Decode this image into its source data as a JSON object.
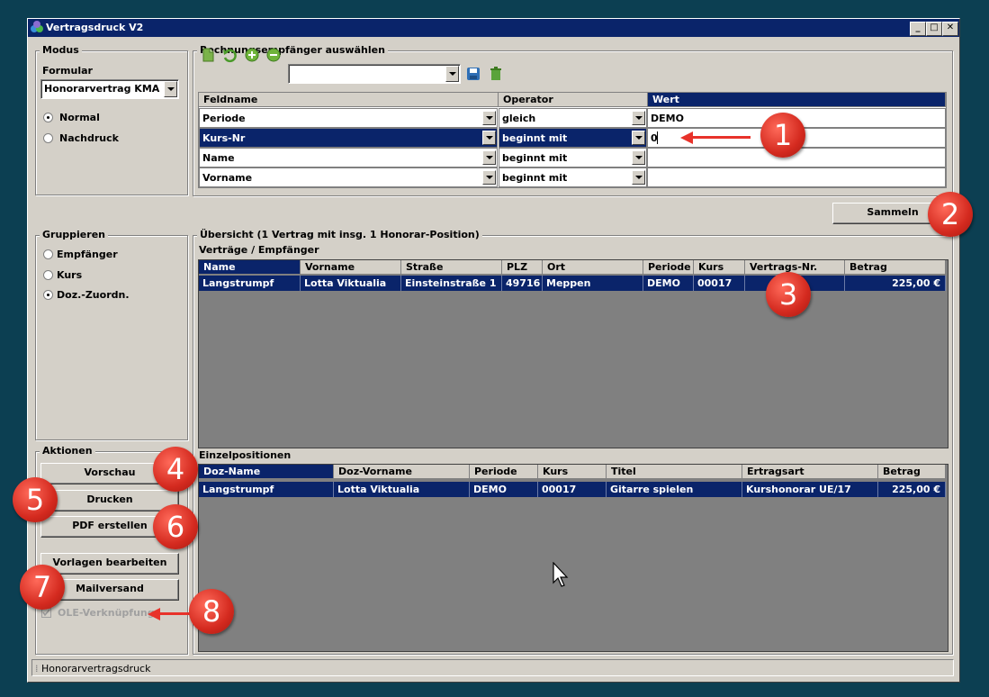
{
  "window": {
    "title": "Vertragsdruck V2",
    "minimize": "_",
    "maximize": "□",
    "close": "✕"
  },
  "modus": {
    "legend": "Modus",
    "formular_label": "Formular",
    "formular_value": "Honorarvertrag KMA",
    "options": [
      {
        "label": "Normal",
        "selected": true
      },
      {
        "label": "Nachdruck",
        "selected": false
      }
    ]
  },
  "empfaenger": {
    "legend": "Rechnungsempfänger auswählen",
    "headers": [
      "Feldname",
      "Operator",
      "Wert"
    ],
    "rows": [
      {
        "field": "Periode",
        "operator": "gleich",
        "value": "DEMO"
      },
      {
        "field": "Kurs-Nr",
        "operator": "beginnt mit",
        "value": "0"
      },
      {
        "field": "Name",
        "operator": "beginnt mit",
        "value": ""
      },
      {
        "field": "Vorname",
        "operator": "beginnt mit",
        "value": ""
      }
    ]
  },
  "sammeln_label": "Sammeln",
  "gruppieren": {
    "legend": "Gruppieren",
    "options": [
      {
        "label": "Empfänger",
        "selected": false
      },
      {
        "label": "Kurs",
        "selected": false
      },
      {
        "label": "Doz.-Zuordn.",
        "selected": true
      }
    ]
  },
  "aktionen": {
    "legend": "Aktionen",
    "vorschau": "Vorschau",
    "drucken": "Drucken",
    "pdf": "PDF erstellen",
    "vorlagen": "Vorlagen bearbeiten",
    "mailversand": "Mailversand",
    "ole": "OLE-Verknüpfung"
  },
  "uebersicht": {
    "legend": "Übersicht (1 Vertrag mit insg. 1 Honorar-Position)",
    "vertraege_label": "Verträge / Empfänger",
    "headers": [
      "Name",
      "Vorname",
      "Straße",
      "PLZ",
      "Ort",
      "Periode",
      "Kurs",
      "Vertrags-Nr.",
      "Betrag"
    ],
    "rows": [
      [
        "Langstrumpf",
        "Lotta Viktualia",
        "Einsteinstraße 1",
        "49716",
        "Meppen",
        "DEMO",
        "00017",
        "",
        "225,00 €"
      ]
    ],
    "einzel_label": "Einzelpositionen",
    "einzel_headers": [
      "Doz-Name",
      "Doz-Vorname",
      "Periode",
      "Kurs",
      "Titel",
      "Ertragsart",
      "Betrag"
    ],
    "einzel_rows": [
      [
        "Langstrumpf",
        "Lotta Viktualia",
        "DEMO",
        "00017",
        "Gitarre spielen",
        "Kurshonorar UE/17",
        "225,00 €"
      ]
    ]
  },
  "status_text": "Honorarvertragsdruck",
  "badges": [
    "1",
    "2",
    "3",
    "4",
    "5",
    "6",
    "7",
    "8"
  ],
  "colors": {
    "selection": "#0a246a",
    "badge": "#d42a1f",
    "background": "#0c3f52"
  }
}
